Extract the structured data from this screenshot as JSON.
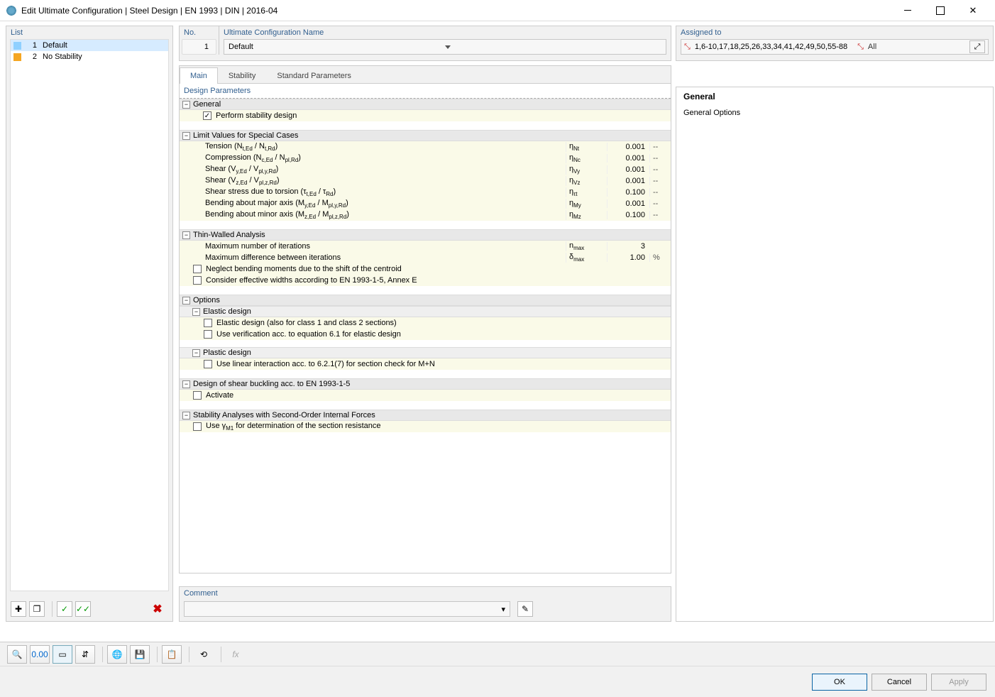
{
  "window_title": "Edit Ultimate Configuration | Steel Design | EN 1993 | DIN | 2016-04",
  "left": {
    "label": "List",
    "items": [
      {
        "num": "1",
        "name": "Default",
        "color": "#8fd0ff",
        "selected": true
      },
      {
        "num": "2",
        "name": "No Stability",
        "color": "#f5a623",
        "selected": false
      }
    ]
  },
  "header": {
    "no_label": "No.",
    "no_value": "1",
    "name_label": "Ultimate Configuration Name",
    "name_value": "Default"
  },
  "tabs": [
    "Main",
    "Stability",
    "Standard Parameters"
  ],
  "active_tab": 0,
  "params_title": "Design Parameters",
  "sections": {
    "general": {
      "title": "General",
      "perform_label": "Perform stability design",
      "perform_checked": true
    },
    "limits": {
      "title": "Limit Values for Special Cases",
      "rows": [
        {
          "label": "Tension (N<sub>t,Ed</sub> / N<sub>t,Rd</sub>)",
          "sym": "η<sub>Nt</sub>",
          "val": "0.001",
          "unit": "--"
        },
        {
          "label": "Compression (N<sub>c,Ed</sub> / N<sub>pl,Rd</sub>)",
          "sym": "η<sub>Nc</sub>",
          "val": "0.001",
          "unit": "--"
        },
        {
          "label": "Shear (V<sub>y,Ed</sub> / V<sub>pl,y,Rd</sub>)",
          "sym": "η<sub>Vy</sub>",
          "val": "0.001",
          "unit": "--"
        },
        {
          "label": "Shear (V<sub>z,Ed</sub> / V<sub>pl,z,Rd</sub>)",
          "sym": "η<sub>Vz</sub>",
          "val": "0.001",
          "unit": "--"
        },
        {
          "label": "Shear stress due to torsion (τ<sub>t,Ed</sub> / τ<sub>Rd</sub>)",
          "sym": "η<sub>τt</sub>",
          "val": "0.100",
          "unit": "--"
        },
        {
          "label": "Bending about major axis (M<sub>y,Ed</sub> / M<sub>pl,y,Rd</sub>)",
          "sym": "η<sub>My</sub>",
          "val": "0.001",
          "unit": "--"
        },
        {
          "label": "Bending about minor axis (M<sub>z,Ed</sub> / M<sub>pl,z,Rd</sub>)",
          "sym": "η<sub>Mz</sub>",
          "val": "0.100",
          "unit": "--"
        }
      ]
    },
    "thin": {
      "title": "Thin-Walled Analysis",
      "rows": [
        {
          "label": "Maximum number of iterations",
          "sym": "n<sub>max</sub>",
          "val": "3",
          "unit": ""
        },
        {
          "label": "Maximum difference between iterations",
          "sym": "δ<sub>max</sub>",
          "val": "1.00",
          "unit": "%"
        }
      ],
      "checks": [
        {
          "label": "Neglect bending moments due to the shift of the centroid",
          "checked": false
        },
        {
          "label": "Consider effective widths according to EN 1993-1-5, Annex E",
          "checked": false
        }
      ]
    },
    "options": {
      "title": "Options",
      "elastic": {
        "title": "Elastic design",
        "rows": [
          {
            "label": "Elastic design (also for class 1 and class 2 sections)",
            "checked": false
          },
          {
            "label": "Use verification acc. to equation 6.1 for elastic design",
            "checked": false
          }
        ]
      },
      "plastic": {
        "title": "Plastic design",
        "rows": [
          {
            "label": "Use linear interaction acc. to 6.2.1(7) for section check for M+N",
            "checked": false
          }
        ]
      }
    },
    "shear_buckling": {
      "title": "Design of shear buckling acc. to EN 1993-1-5",
      "activate_label": "Activate",
      "activate_checked": false
    },
    "stability": {
      "title": "Stability Analyses with Second-Order Internal Forces",
      "gamma_label": "Use γ<sub>M1</sub> for determination of the section resistance",
      "gamma_checked": false
    }
  },
  "comment_label": "Comment",
  "assigned": {
    "label": "Assigned to",
    "text": "1,6-10,17,18,25,26,33,34,41,42,49,50,55-88",
    "all": "All"
  },
  "info": {
    "heading": "General",
    "body": "General Options"
  },
  "buttons": {
    "ok": "OK",
    "cancel": "Cancel",
    "apply": "Apply"
  }
}
